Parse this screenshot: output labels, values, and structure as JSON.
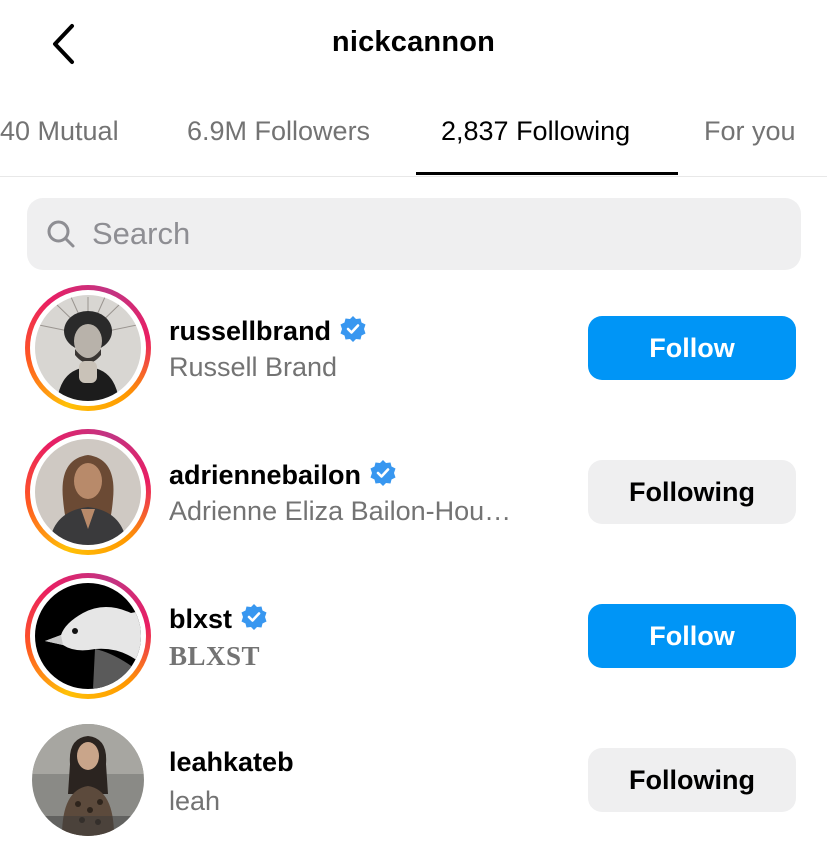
{
  "header": {
    "title": "nickcannon"
  },
  "tabs": [
    {
      "label": "40 Mutual"
    },
    {
      "label": "6.9M Followers"
    },
    {
      "label": "2,837 Following"
    },
    {
      "label": "For you"
    }
  ],
  "search": {
    "placeholder": "Search",
    "value": ""
  },
  "users": [
    {
      "username": "russellbrand",
      "full_name": "Russell Brand",
      "verified": true,
      "story_ring": true,
      "button": "Follow"
    },
    {
      "username": "adriennebailon",
      "full_name": "Adrienne Eliza Bailon-Hou…",
      "verified": true,
      "story_ring": true,
      "button": "Following"
    },
    {
      "username": "blxst",
      "full_name": "BLXST",
      "verified": true,
      "story_ring": true,
      "button": "Follow"
    },
    {
      "username": "leahkateb",
      "full_name": "leah",
      "verified": false,
      "story_ring": false,
      "button": "Following"
    }
  ],
  "colors": {
    "follow_blue": "#0095f6",
    "verified_blue": "#3897f0",
    "muted_text": "#737373"
  }
}
